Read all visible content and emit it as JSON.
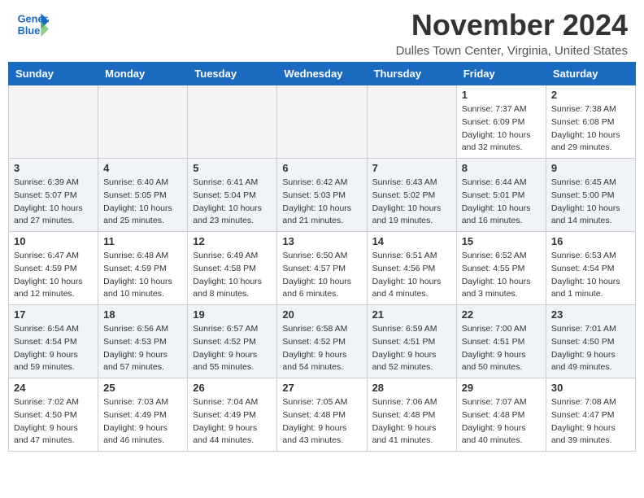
{
  "header": {
    "logo_line1": "General",
    "logo_line2": "Blue",
    "month_title": "November 2024",
    "location": "Dulles Town Center, Virginia, United States"
  },
  "weekdays": [
    "Sunday",
    "Monday",
    "Tuesday",
    "Wednesday",
    "Thursday",
    "Friday",
    "Saturday"
  ],
  "weeks": [
    [
      {
        "day": "",
        "info": ""
      },
      {
        "day": "",
        "info": ""
      },
      {
        "day": "",
        "info": ""
      },
      {
        "day": "",
        "info": ""
      },
      {
        "day": "",
        "info": ""
      },
      {
        "day": "1",
        "info": "Sunrise: 7:37 AM\nSunset: 6:09 PM\nDaylight: 10 hours and 32 minutes."
      },
      {
        "day": "2",
        "info": "Sunrise: 7:38 AM\nSunset: 6:08 PM\nDaylight: 10 hours and 29 minutes."
      }
    ],
    [
      {
        "day": "3",
        "info": "Sunrise: 6:39 AM\nSunset: 5:07 PM\nDaylight: 10 hours and 27 minutes."
      },
      {
        "day": "4",
        "info": "Sunrise: 6:40 AM\nSunset: 5:05 PM\nDaylight: 10 hours and 25 minutes."
      },
      {
        "day": "5",
        "info": "Sunrise: 6:41 AM\nSunset: 5:04 PM\nDaylight: 10 hours and 23 minutes."
      },
      {
        "day": "6",
        "info": "Sunrise: 6:42 AM\nSunset: 5:03 PM\nDaylight: 10 hours and 21 minutes."
      },
      {
        "day": "7",
        "info": "Sunrise: 6:43 AM\nSunset: 5:02 PM\nDaylight: 10 hours and 19 minutes."
      },
      {
        "day": "8",
        "info": "Sunrise: 6:44 AM\nSunset: 5:01 PM\nDaylight: 10 hours and 16 minutes."
      },
      {
        "day": "9",
        "info": "Sunrise: 6:45 AM\nSunset: 5:00 PM\nDaylight: 10 hours and 14 minutes."
      }
    ],
    [
      {
        "day": "10",
        "info": "Sunrise: 6:47 AM\nSunset: 4:59 PM\nDaylight: 10 hours and 12 minutes."
      },
      {
        "day": "11",
        "info": "Sunrise: 6:48 AM\nSunset: 4:59 PM\nDaylight: 10 hours and 10 minutes."
      },
      {
        "day": "12",
        "info": "Sunrise: 6:49 AM\nSunset: 4:58 PM\nDaylight: 10 hours and 8 minutes."
      },
      {
        "day": "13",
        "info": "Sunrise: 6:50 AM\nSunset: 4:57 PM\nDaylight: 10 hours and 6 minutes."
      },
      {
        "day": "14",
        "info": "Sunrise: 6:51 AM\nSunset: 4:56 PM\nDaylight: 10 hours and 4 minutes."
      },
      {
        "day": "15",
        "info": "Sunrise: 6:52 AM\nSunset: 4:55 PM\nDaylight: 10 hours and 3 minutes."
      },
      {
        "day": "16",
        "info": "Sunrise: 6:53 AM\nSunset: 4:54 PM\nDaylight: 10 hours and 1 minute."
      }
    ],
    [
      {
        "day": "17",
        "info": "Sunrise: 6:54 AM\nSunset: 4:54 PM\nDaylight: 9 hours and 59 minutes."
      },
      {
        "day": "18",
        "info": "Sunrise: 6:56 AM\nSunset: 4:53 PM\nDaylight: 9 hours and 57 minutes."
      },
      {
        "day": "19",
        "info": "Sunrise: 6:57 AM\nSunset: 4:52 PM\nDaylight: 9 hours and 55 minutes."
      },
      {
        "day": "20",
        "info": "Sunrise: 6:58 AM\nSunset: 4:52 PM\nDaylight: 9 hours and 54 minutes."
      },
      {
        "day": "21",
        "info": "Sunrise: 6:59 AM\nSunset: 4:51 PM\nDaylight: 9 hours and 52 minutes."
      },
      {
        "day": "22",
        "info": "Sunrise: 7:00 AM\nSunset: 4:51 PM\nDaylight: 9 hours and 50 minutes."
      },
      {
        "day": "23",
        "info": "Sunrise: 7:01 AM\nSunset: 4:50 PM\nDaylight: 9 hours and 49 minutes."
      }
    ],
    [
      {
        "day": "24",
        "info": "Sunrise: 7:02 AM\nSunset: 4:50 PM\nDaylight: 9 hours and 47 minutes."
      },
      {
        "day": "25",
        "info": "Sunrise: 7:03 AM\nSunset: 4:49 PM\nDaylight: 9 hours and 46 minutes."
      },
      {
        "day": "26",
        "info": "Sunrise: 7:04 AM\nSunset: 4:49 PM\nDaylight: 9 hours and 44 minutes."
      },
      {
        "day": "27",
        "info": "Sunrise: 7:05 AM\nSunset: 4:48 PM\nDaylight: 9 hours and 43 minutes."
      },
      {
        "day": "28",
        "info": "Sunrise: 7:06 AM\nSunset: 4:48 PM\nDaylight: 9 hours and 41 minutes."
      },
      {
        "day": "29",
        "info": "Sunrise: 7:07 AM\nSunset: 4:48 PM\nDaylight: 9 hours and 40 minutes."
      },
      {
        "day": "30",
        "info": "Sunrise: 7:08 AM\nSunset: 4:47 PM\nDaylight: 9 hours and 39 minutes."
      }
    ]
  ]
}
